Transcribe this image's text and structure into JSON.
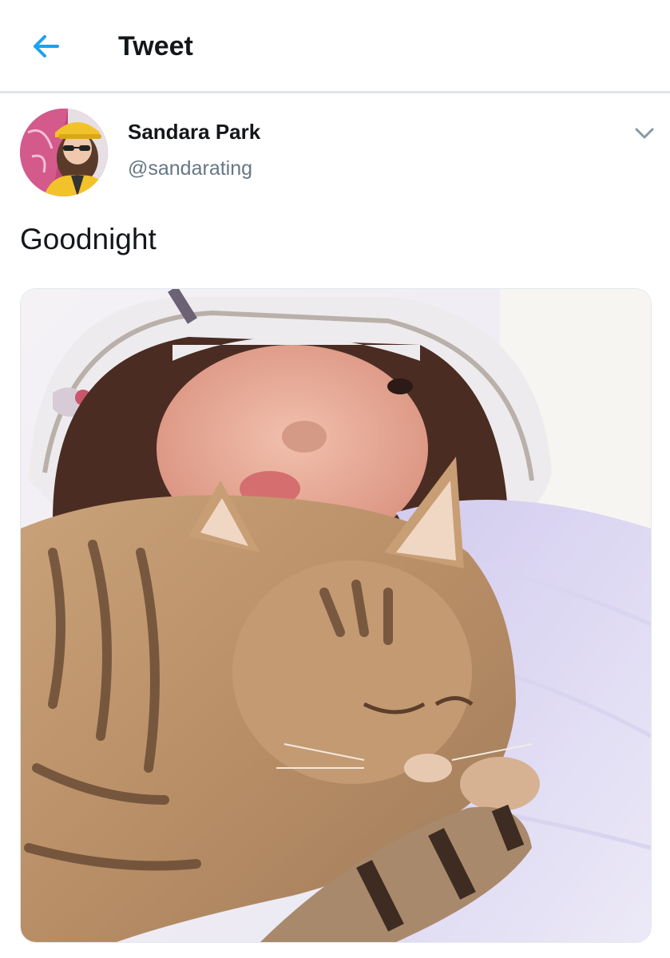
{
  "header": {
    "title": "Tweet",
    "back_icon": "arrow-left-icon"
  },
  "tweet": {
    "author_name": "Sandara Park",
    "author_handle": "@sandarating",
    "text": "Goodnight",
    "more_icon": "chevron-down-icon",
    "media": "photo"
  },
  "colors": {
    "accent": "#1da1f2",
    "text_primary": "#14171a",
    "text_secondary": "#657786",
    "divider": "#e1e5e9"
  }
}
